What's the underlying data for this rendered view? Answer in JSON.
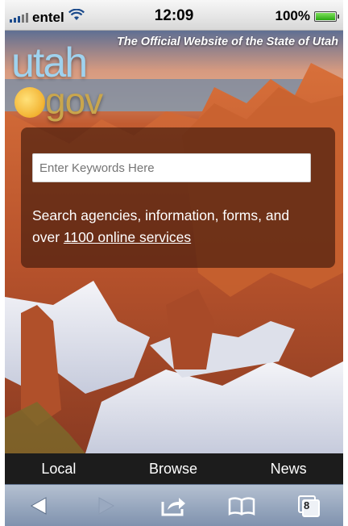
{
  "status_bar": {
    "carrier": "entel",
    "time": "12:09",
    "battery": "100%",
    "battery_level": 1.0
  },
  "header": {
    "tagline": "The Official Website of the State of Utah",
    "logo_top": "utah",
    "logo_bottom": "gov"
  },
  "search": {
    "placeholder": "Enter Keywords Here",
    "value": "",
    "description_prefix": "Search agencies, information, forms, and over ",
    "description_link": "1100 online services"
  },
  "bottom_nav": {
    "items": [
      {
        "label": "Local"
      },
      {
        "label": "Browse"
      },
      {
        "label": "News"
      }
    ]
  },
  "toolbar": {
    "tabs_count": "8",
    "icons": [
      "back-arrow-icon",
      "forward-arrow-icon",
      "share-icon",
      "bookmarks-icon",
      "tabs-icon"
    ]
  },
  "colors": {
    "status_bar_bg": "#e8e8e8",
    "overlay_panel": "#461c0e",
    "bottom_nav_bg": "#1c1c1c",
    "toolbar_bg": "#8d9eb8",
    "battery_fill": "#2aa812",
    "logo_utah": "#9fd2ee",
    "logo_gov": "#c9a64d"
  }
}
